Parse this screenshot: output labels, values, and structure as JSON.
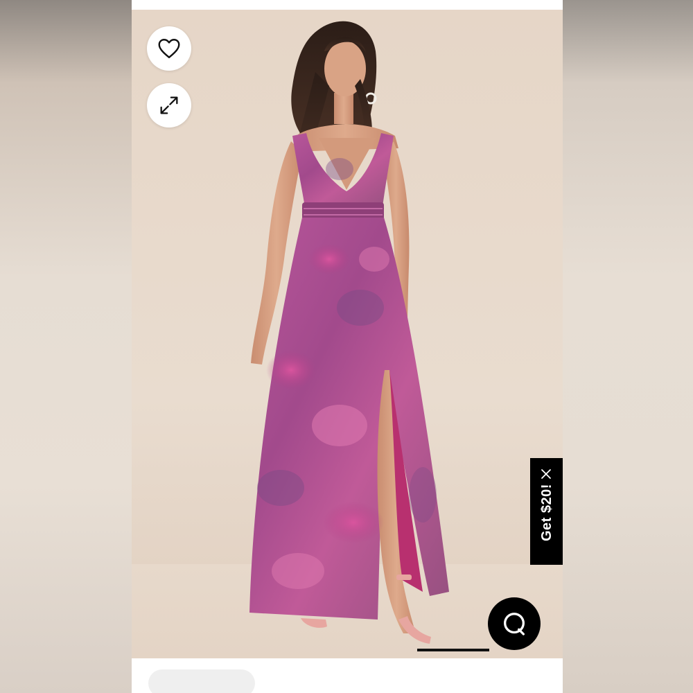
{
  "product_viewer": {
    "actions": {
      "favorite_icon": "heart-outline-icon",
      "expand_icon": "expand-arrows-icon"
    },
    "promo": {
      "label": "Get $20!",
      "close_icon": "close-x-icon"
    },
    "chat": {
      "icon": "chat-bubble-icon"
    }
  },
  "colors": {
    "promo_bg": "#000000",
    "promo_text": "#ffffff",
    "photo_bg": "#e7d8ca",
    "dress_magenta": "#b23f86",
    "dress_purple": "#7b4b86",
    "shoe_pink": "#e7a6a0"
  }
}
